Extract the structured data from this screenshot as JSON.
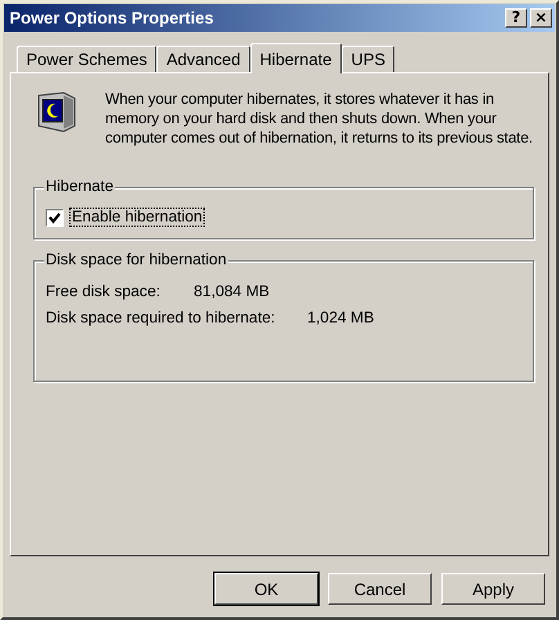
{
  "window": {
    "title": "Power Options Properties",
    "controls": [
      "?",
      "×"
    ]
  },
  "tabs": [
    {
      "label": "Power Schemes",
      "selected": false
    },
    {
      "label": "Advanced",
      "selected": false
    },
    {
      "label": "Hibernate",
      "selected": true
    },
    {
      "label": "UPS",
      "selected": false
    }
  ],
  "description": "When your computer hibernates, it stores whatever it has in memory on your hard disk and then shuts down. When your computer comes out of hibernation, it returns to its previous state.",
  "hibernate_group": {
    "title": "Hibernate",
    "checkbox": {
      "label": "Enable hibernation",
      "checked": true
    }
  },
  "disk_group": {
    "title": "Disk space for hibernation",
    "rows": [
      {
        "label": "Free disk space:",
        "value": "81,084 MB"
      },
      {
        "label": "Disk space required to hibernate:",
        "value": "1,024 MB"
      }
    ]
  },
  "buttons": [
    {
      "label": "OK",
      "kind": "default"
    },
    {
      "label": "Cancel",
      "kind": "normal"
    },
    {
      "label": "Apply",
      "kind": "normal"
    }
  ]
}
